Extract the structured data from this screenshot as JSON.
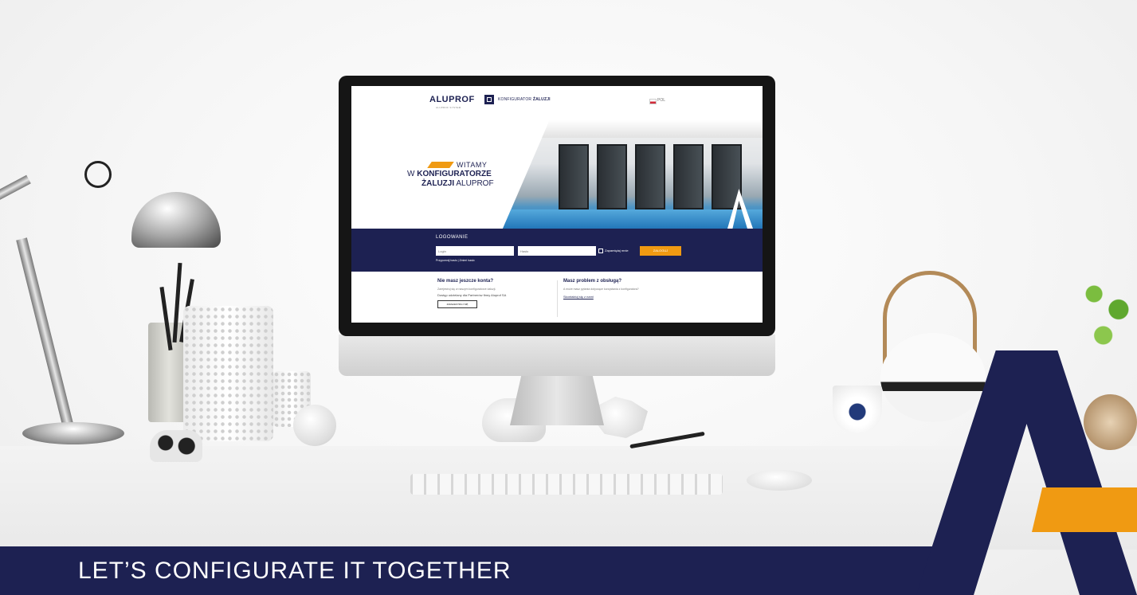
{
  "screen": {
    "header": {
      "logo_text": "ALUPROF",
      "logo_subtitle": "ALUPROF SYSTEM",
      "configurator_label": "KONFIGURATOR",
      "configurator_product": "ŻALUZJI",
      "language": "POL"
    },
    "hero": {
      "line1": "WITAMY",
      "line2_prefix": "W ",
      "line2_bold": "KONFIGURATORZE",
      "line3_bold": "ŻALUZJI",
      "line3_suffix": " ALUPROF"
    },
    "login": {
      "title": "LOGOWANIE",
      "login_placeholder": "Login",
      "password_placeholder": "Hasło",
      "remember_label": "Zapamiętaj mnie",
      "submit_label": "ZALOGUJ",
      "forgot_label": "Przypomnij hasło | Zmień hasło"
    },
    "no_account": {
      "heading": "Nie masz jeszcze konta?",
      "text": "Zarejestruj się w naszym konfiguratorze żaluzji.",
      "text2": "Dostęp udzielany dla Partnerów firmy Aluprof SA",
      "register_label": "ZAREJESTRUJ SIĘ"
    },
    "support": {
      "heading": "Masz problem z obsługą?",
      "text": "A może masz pytania dotyczące korzystania z konfiguratora?",
      "link_label": "Skontaktuj się z nami"
    }
  },
  "banner": {
    "tagline": "LET’S CONFIGURATE IT TOGETHER"
  },
  "colors": {
    "brand_navy": "#1d2152",
    "brand_orange": "#f09a12"
  }
}
